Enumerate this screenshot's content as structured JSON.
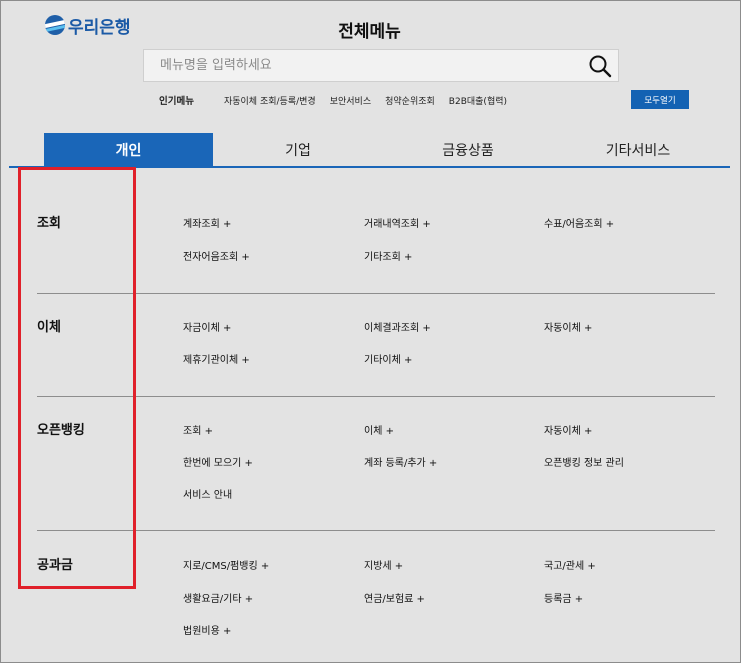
{
  "brand": {
    "logo_text": "우리은행"
  },
  "header": {
    "title": "전체메뉴"
  },
  "search": {
    "placeholder": "메뉴명을 입력하세요",
    "value": ""
  },
  "popular": {
    "label": "인기메뉴",
    "keywords": [
      "자동이체 조회/등록/변경",
      "보안서비스",
      "청약순위조회",
      "B2B대출(협력)"
    ]
  },
  "open_all_label": "모두열기",
  "tabs": [
    {
      "label": "개인",
      "active": true
    },
    {
      "label": "기업"
    },
    {
      "label": "금융상품"
    },
    {
      "label": "기타서비스"
    }
  ],
  "sections": [
    {
      "title": "조회",
      "items": [
        "계좌조회 +",
        "거래내역조회 +",
        "수표/어음조회 +",
        "전자어음조회 +",
        "기타조회 +"
      ]
    },
    {
      "title": "이체",
      "items": [
        "자금이체 +",
        "이체결과조회 +",
        "자동이체 +",
        "제휴기관이체 +",
        "기타이체 +"
      ]
    },
    {
      "title": "오픈뱅킹",
      "items": [
        "조회 +",
        "이체 +",
        "자동이체 +",
        "한번에 모으기 +",
        "계좌 등록/추가 +",
        "오픈뱅킹 정보 관리",
        "서비스 안내"
      ]
    },
    {
      "title": "공과금",
      "items": [
        "지로/CMS/펌뱅킹 +",
        "지방세 +",
        "국고/관세 +",
        "생활요금/기타 +",
        "연금/보험료 +",
        "등록금 +",
        "법원비용 +"
      ]
    }
  ],
  "colors": {
    "brand_blue": "#1a66b8",
    "highlight_red": "#e0202a",
    "background": "#e3e3e3"
  }
}
